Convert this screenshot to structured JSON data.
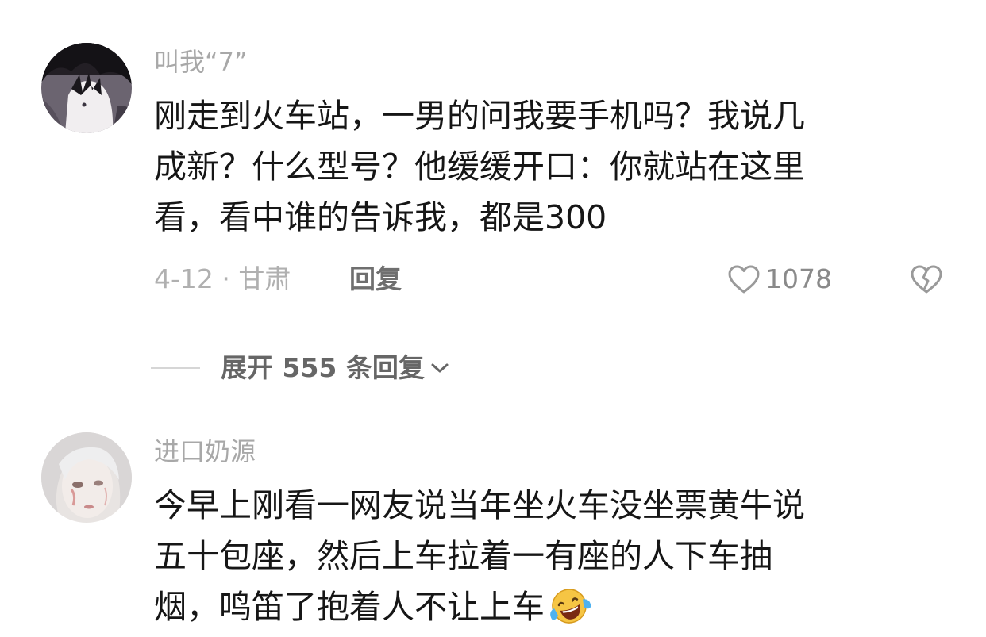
{
  "comments": [
    {
      "username": "叫我“7”",
      "text_lines": [
        "刚走到火车站，一男的问我要手机吗？我说几",
        "成新？什么型号？他缓缓开口：你就站在这里",
        "看，看中谁的告诉我，都是300"
      ],
      "date_location": "4-12 · 甘肃",
      "reply_label": "回复",
      "like_count": "1078",
      "like_icon": "heart-outline-icon",
      "dislike_icon": "broken-heart-icon"
    },
    {
      "username": "进口奶源",
      "text_lines": [
        "今早上刚看一网友说当年坐火车没坐票黄牛说",
        "五十包座，然后上车拉着一有座的人下车抽",
        "烟，鸣笛了抱着人不让上车"
      ],
      "emoji": "laughing-crying-emoji"
    }
  ],
  "replies_toggle": {
    "label": "展开 555 条回复",
    "icon": "chevron-down-icon"
  },
  "colors": {
    "username": "#a8a8a8",
    "text": "#161616",
    "meta": "#b0b0b0",
    "emoji_face": "#f6c544"
  }
}
